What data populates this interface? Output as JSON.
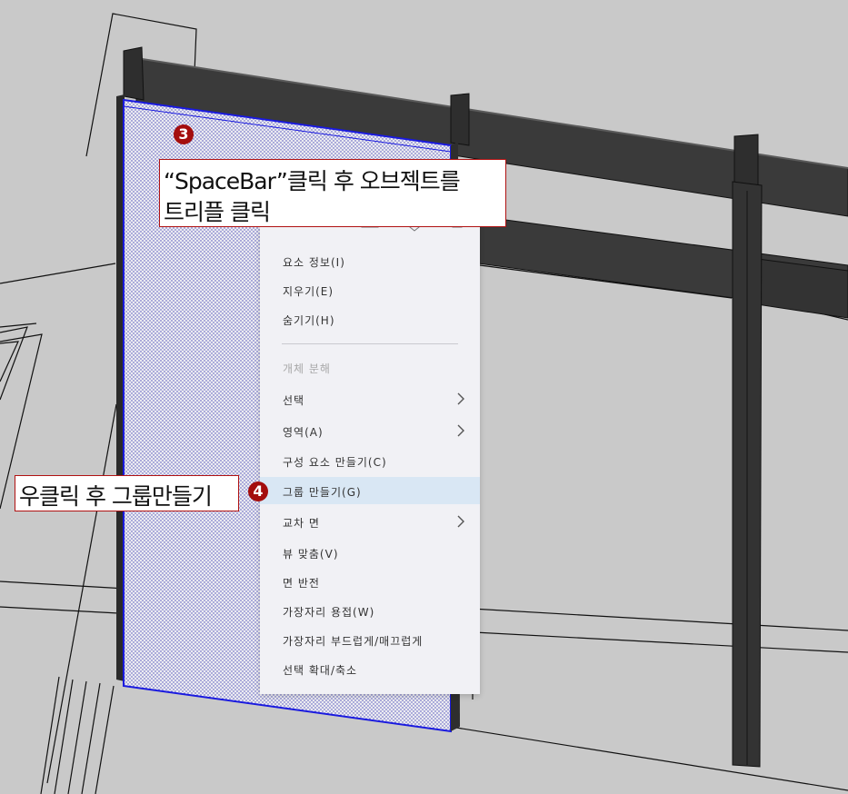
{
  "callouts": {
    "step3": {
      "number": "3",
      "line1": "“SpaceBar”클릭  후 오브젝트를",
      "line2": "트리플 클릭"
    },
    "step4": {
      "number": "4",
      "text": "우클릭 후 그룹만들기"
    }
  },
  "context_menu": {
    "items": [
      {
        "label": "요소 정보(I)"
      },
      {
        "label": "지우기(E)"
      },
      {
        "label": "숨기기(H)"
      },
      {
        "label": "개체 분해",
        "disabled": true
      },
      {
        "label": "선택",
        "submenu": true
      },
      {
        "label": "영역(A)",
        "submenu": true
      },
      {
        "label": "구성 요소 만들기(C)"
      },
      {
        "label": "그룹 만들기(G)",
        "highlighted": true
      },
      {
        "label": "교차 면",
        "submenu": true
      },
      {
        "label": "뷰 맞춤(V)"
      },
      {
        "label": "면 반전"
      },
      {
        "label": "가장자리 용접(W)"
      },
      {
        "label": "가장자리 부드럽게/매끄럽게"
      },
      {
        "label": "선택 확대/축소"
      }
    ]
  },
  "colors": {
    "viewport_bg": "#c9c9c9",
    "selection_blue": "#1a1adf",
    "callout_border": "#b01212",
    "badge_red": "#a40d0d",
    "menu_bg": "#f1f1f5",
    "menu_highlight": "#d9e7f4",
    "beam_dark": "#3a3a3a"
  }
}
